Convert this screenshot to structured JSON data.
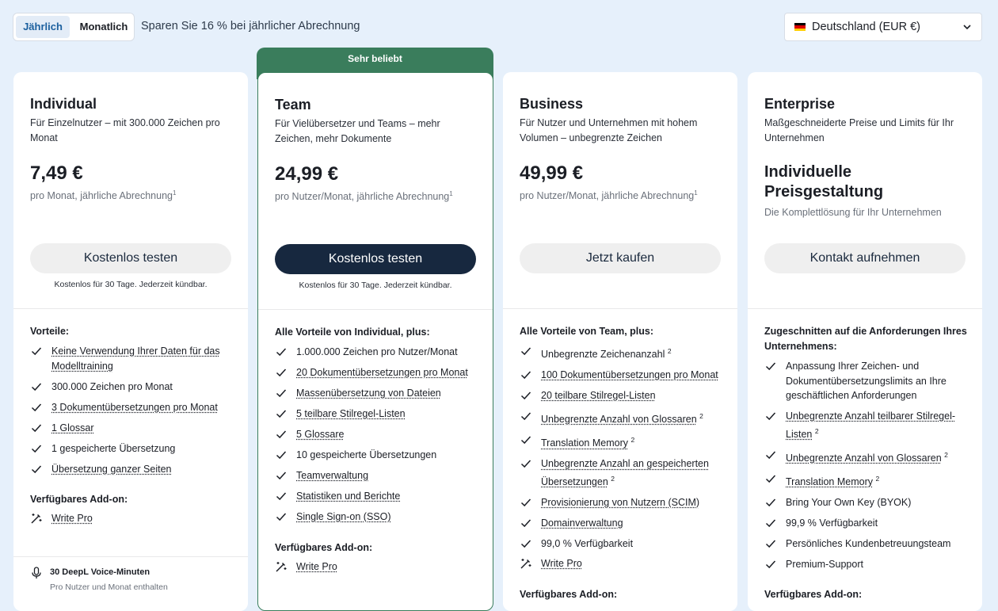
{
  "billing": {
    "yearly_label": "Jährlich",
    "monthly_label": "Monatlich",
    "save_text": "Sparen Sie 16 % bei jährlicher Abrechnung"
  },
  "country": {
    "label": "Deutschland (EUR €)"
  },
  "popular_badge": "Sehr beliebt",
  "plans": [
    {
      "name": "Individual",
      "desc": "Für Einzelnutzer – mit 300.000 Zeichen pro Monat",
      "price": "7,49 €",
      "price_note": "pro Monat, jährliche Abrechnung",
      "footnote": "1",
      "cta": "Kostenlos testen",
      "cta_note": "Kostenlos für 30 Tage. Jederzeit kündbar.",
      "features_title": "Vorteile:",
      "features": [
        {
          "text": "Keine Verwendung Ihrer Daten für das Modelltraining",
          "sup": ""
        },
        {
          "text": "300.000 Zeichen pro Monat",
          "sup": ""
        },
        {
          "text": "3 Dokumentübersetzungen pro Monat",
          "sup": ""
        },
        {
          "text": "1 Glossar",
          "sup": ""
        },
        {
          "text": "1 gespeicherte Übersetzung",
          "sup": ""
        },
        {
          "text": "Übersetzung ganzer Seiten",
          "sup": ""
        }
      ],
      "addon_title": "Verfügbares Add-on:",
      "addon": "Write Pro",
      "voice_title": "30 DeepL Voice-Minuten",
      "voice_sub": "Pro Nutzer und Monat enthalten"
    },
    {
      "name": "Team",
      "desc": "Für Vielübersetzer und Teams – mehr Zeichen, mehr Dokumente",
      "price": "24,99 €",
      "price_note": "pro Nutzer/Monat, jährliche Abrechnung",
      "footnote": "1",
      "cta": "Kostenlos testen",
      "cta_note": "Kostenlos für 30 Tage. Jederzeit kündbar.",
      "features_title": "Alle Vorteile von Individual, plus:",
      "features": [
        {
          "text": "1.000.000 Zeichen pro Nutzer/Monat",
          "sup": ""
        },
        {
          "text": "20 Dokumentübersetzungen pro Monat",
          "sup": ""
        },
        {
          "text": "Massenübersetzung von Dateien",
          "sup": ""
        },
        {
          "text": "5 teilbare Stilregel-Listen",
          "sup": ""
        },
        {
          "text": "5 Glossare",
          "sup": ""
        },
        {
          "text": "10 gespeicherte Übersetzungen",
          "sup": ""
        },
        {
          "text": "Teamverwaltung",
          "sup": ""
        },
        {
          "text": "Statistiken und Berichte",
          "sup": ""
        },
        {
          "text": "Single Sign-on (SSO)",
          "sup": ""
        }
      ],
      "addon_title": "Verfügbares Add-on:",
      "addon": "Write Pro"
    },
    {
      "name": "Business",
      "desc": "Für Nutzer und Unternehmen mit hohem Volumen – unbegrenzte Zeichen",
      "price": "49,99 €",
      "price_note": "pro Nutzer/Monat, jährliche Abrechnung",
      "footnote": "1",
      "cta": "Jetzt kaufen",
      "features_title": "Alle Vorteile von Team, plus:",
      "features": [
        {
          "text": "Unbegrenzte Zeichenanzahl",
          "sup": "2"
        },
        {
          "text": "100 Dokumentübersetzungen pro Monat",
          "sup": ""
        },
        {
          "text": "20 teilbare Stilregel-Listen",
          "sup": ""
        },
        {
          "text": "Unbegrenzte Anzahl von Glossaren",
          "sup": "2"
        },
        {
          "text": "Translation Memory",
          "sup": "2"
        },
        {
          "text": "Unbegrenzte Anzahl an gespeicherten Übersetzungen",
          "sup": "2"
        },
        {
          "text": "Provisionierung von Nutzern (SCIM)",
          "sup": ""
        },
        {
          "text": "Domainverwaltung",
          "sup": ""
        },
        {
          "text": "99,0 % Verfügbarkeit",
          "sup": ""
        }
      ],
      "extra_feature": "Write Pro",
      "addon_title": "Verfügbares Add-on:"
    },
    {
      "name": "Enterprise",
      "desc": "Maßgeschneiderte Preise und Limits für Ihr Unternehmen",
      "price": "Individuelle Preisgestaltung",
      "price_note": "Die Komplettlösung für Ihr Unternehmen",
      "cta": "Kontakt aufnehmen",
      "features_title": "Zugeschnitten auf die Anforderungen Ihres Unternehmens:",
      "features": [
        {
          "text": "Anpassung Ihrer Zeichen- und Dokumentübersetzungslimits an Ihre geschäftlichen Anforderungen",
          "sup": ""
        },
        {
          "text": "Unbegrenzte Anzahl teilbarer Stilregel-Listen",
          "sup": "2"
        },
        {
          "text": "Unbegrenzte Anzahl von Glossaren",
          "sup": "2"
        },
        {
          "text": "Translation Memory",
          "sup": "2"
        },
        {
          "text": "Bring Your Own Key (BYOK)",
          "sup": ""
        },
        {
          "text": "99,9 % Verfügbarkeit",
          "sup": ""
        },
        {
          "text": "Persönliches Kundenbetreuungsteam",
          "sup": ""
        },
        {
          "text": "Premium-Support",
          "sup": ""
        }
      ],
      "addon_title": "Verfügbares Add-on:"
    }
  ]
}
